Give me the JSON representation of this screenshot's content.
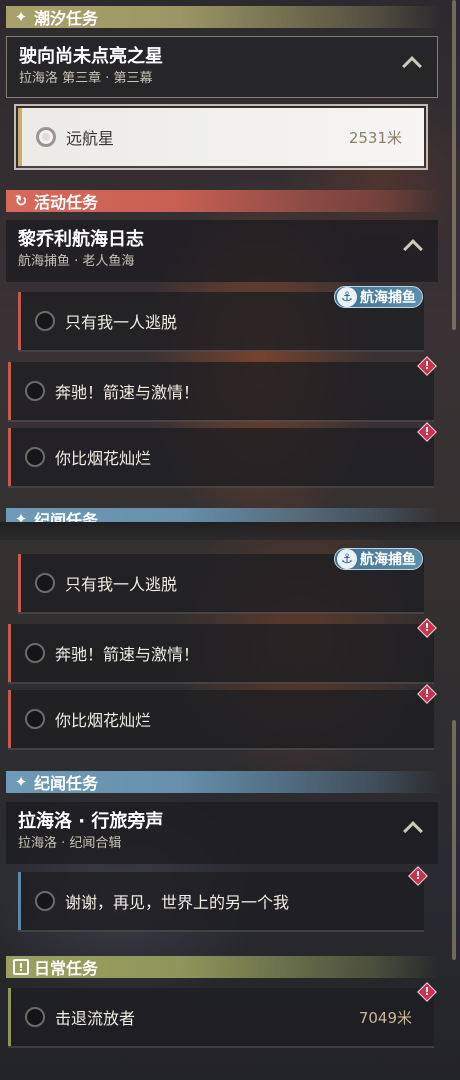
{
  "headers": {
    "chaoxi": "潮汐任务",
    "huodong": "活动任务",
    "jiwen": "纪闻任务",
    "richang": "日常任务"
  },
  "chaoxi_group": {
    "title": "驶向尚未点亮之星",
    "subtitle": "拉海洛 第三章 · 第三幕",
    "task": {
      "name": "远航星",
      "distance": "2531米"
    }
  },
  "huodong_group": {
    "title": "黎乔利航海日志",
    "subtitle": "航海捕鱼 · 老人鱼海",
    "tag": "航海捕鱼",
    "tasks": [
      "只有我一人逃脱",
      "奔驰！箭速与激情！",
      "你比烟花灿烂"
    ]
  },
  "jiwen_group": {
    "title": "拉海洛 · 行旅旁声",
    "subtitle": "拉海洛 · 纪闻合辑",
    "tasks": [
      "谢谢，再见，世界上的另一个我"
    ]
  },
  "richang_group": {
    "tasks": [
      {
        "name": "击退流放者",
        "distance": "7049米"
      }
    ]
  },
  "colors": {
    "chaoxi": "#a8a26a",
    "huodong": "#d86a5a",
    "jiwen": "#6e9ab8",
    "richang": "#9aa160",
    "warning": "#c8344f"
  }
}
